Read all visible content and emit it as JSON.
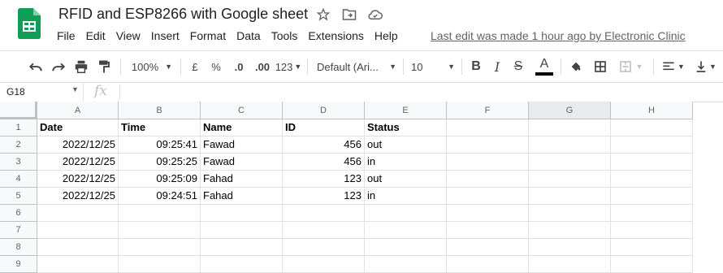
{
  "app": {
    "title": "RFID and ESP8266 with Google sheet",
    "last_edit": "Last edit was made 1 hour ago by Electronic Clinic",
    "menu": [
      "File",
      "Edit",
      "View",
      "Insert",
      "Format",
      "Data",
      "Tools",
      "Extensions",
      "Help"
    ]
  },
  "toolbar": {
    "zoom": "100%",
    "currency": "£",
    "percent": "%",
    "decrease_decimal": ".0",
    "increase_decimal": ".00",
    "more_formats": "123",
    "font": "Default (Ari...",
    "font_size": "10",
    "bold": "B",
    "italic": "I",
    "strikethrough": "S",
    "text_color": "A"
  },
  "formula_bar": {
    "cell_ref": "G18",
    "fx": "fx",
    "value": ""
  },
  "sheet": {
    "columns": [
      "A",
      "B",
      "C",
      "D",
      "E",
      "F",
      "G",
      "H"
    ],
    "row_numbers": [
      "1",
      "2",
      "3",
      "4",
      "5",
      "6",
      "7",
      "8",
      "9"
    ],
    "rows": [
      [
        "Date",
        "Time",
        "Name",
        "ID",
        "Status",
        "",
        "",
        ""
      ],
      [
        "2022/12/25",
        "09:25:41",
        "Fawad",
        "456",
        "out",
        "",
        "",
        ""
      ],
      [
        "2022/12/25",
        "09:25:25",
        "Fawad",
        "456",
        "in",
        "",
        "",
        ""
      ],
      [
        "2022/12/25",
        "09:25:09",
        "Fahad",
        "123",
        "out",
        "",
        "",
        ""
      ],
      [
        "2022/12/25",
        "09:24:51",
        "Fahad",
        "123",
        "in",
        "",
        "",
        ""
      ],
      [
        "",
        "",
        "",
        "",
        "",
        "",
        "",
        ""
      ],
      [
        "",
        "",
        "",
        "",
        "",
        "",
        "",
        ""
      ],
      [
        "",
        "",
        "",
        "",
        "",
        "",
        "",
        ""
      ],
      [
        "",
        "",
        "",
        "",
        "",
        "",
        "",
        ""
      ]
    ]
  },
  "colors": {
    "logo_green": "#0f9d58",
    "text_color_bar": "#000000"
  }
}
